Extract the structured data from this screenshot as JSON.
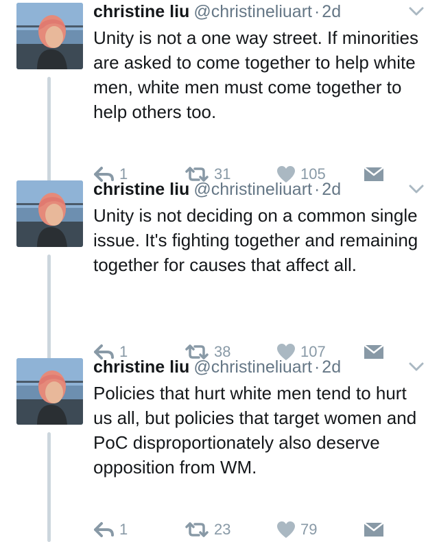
{
  "tweets": [
    {
      "author_name": "christine liu",
      "handle": "@christineliuart",
      "separator": "·",
      "time": "2d",
      "text": "Unity is not a one way street. If minorities are asked to come together to help white men, white men must come together to help others too.",
      "replies": "1",
      "retweets": "31",
      "likes": "105"
    },
    {
      "author_name": "christine liu",
      "handle": "@christineliuart",
      "separator": "·",
      "time": "2d",
      "text": "Unity is not deciding on a common single issue. It's fighting together and remaining together for causes that affect all.",
      "replies": "1",
      "retweets": "38",
      "likes": "107"
    },
    {
      "author_name": "christine liu",
      "handle": "@christineliuart",
      "separator": "·",
      "time": "2d",
      "text": "Policies that hurt white men tend to hurt us all, but policies that target women and PoC disproportionately also deserve opposition from WM.",
      "replies": "1",
      "retweets": "23",
      "likes": "79"
    }
  ],
  "icons": {
    "caret": "chevron-down-icon",
    "reply": "reply-icon",
    "retweet": "retweet-icon",
    "like": "heart-icon",
    "dm": "envelope-icon"
  },
  "colors": {
    "text": "#14171a",
    "secondary": "#657786",
    "action_gray": "#8899a6",
    "thread_line": "#ccd6dd"
  }
}
